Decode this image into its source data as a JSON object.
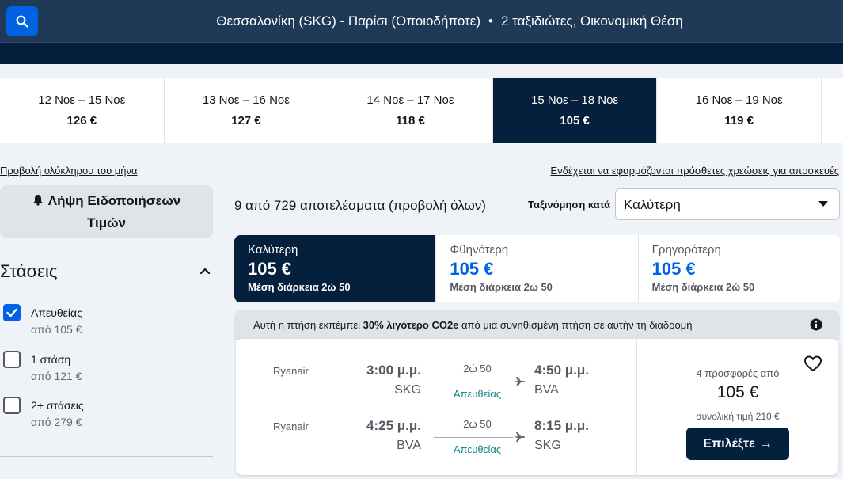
{
  "search": {
    "route": "Θεσσαλονίκη (SKG) - Παρίσι (Οποιοδήποτε)",
    "separator": "•",
    "travellers": "2 ταξιδιώτες, Οικονομική Θέση"
  },
  "dates": [
    {
      "range": "12 Νοε – 15 Νοε",
      "price": "126 €"
    },
    {
      "range": "13 Νοε – 16 Νοε",
      "price": "127 €"
    },
    {
      "range": "14 Νοε – 17 Νοε",
      "price": "118 €"
    },
    {
      "range": "15 Νοε – 18 Νοε",
      "price": "105 €",
      "selected": true
    },
    {
      "range": "16 Νοε – 19 Νοε",
      "price": "119 €"
    }
  ],
  "links": {
    "month": "Προβολή ολόκληρου του μήνα",
    "baggage": "Ενδέχεται να εφαρμόζονται πρόσθετες χρεώσεις για αποσκευές"
  },
  "alerts": {
    "label": "Λήψη Ειδοποιήσεων Τιμών"
  },
  "filters": {
    "stops_title": "Στάσεις",
    "items": [
      {
        "label": "Απευθείας",
        "price": "από 105 €",
        "checked": true
      },
      {
        "label": "1 στάση",
        "price": "από 121 €",
        "checked": false
      },
      {
        "label": "2+ στάσεις",
        "price": "από 279 €",
        "checked": false
      }
    ]
  },
  "results": {
    "count": "9 από 729 αποτελέσματα (προβολή όλων)",
    "sort_label": "Ταξινόμηση κατά",
    "sort_value": "Καλύτερη"
  },
  "sort_tabs": [
    {
      "title": "Καλύτερη",
      "price": "105 €",
      "duration": "Μέση διάρκεια 2ώ 50",
      "active": true
    },
    {
      "title": "Φθηνότερη",
      "price": "105 €",
      "duration": "Μέση διάρκεια 2ώ 50",
      "active": false
    },
    {
      "title": "Γρηγορότερη",
      "price": "105 €",
      "duration": "Μέση διάρκεια 2ώ 50",
      "active": false
    }
  ],
  "eco": {
    "prefix": "Αυτή η πτήση εκπέμπει ",
    "highlight": "30% λιγότερο CO2e",
    "suffix": " από μια συνηθισμένη πτήση σε αυτήν τη διαδρομή"
  },
  "flight": {
    "legs": [
      {
        "airline": "Ryanair",
        "dep_time": "3:00 μ.μ.",
        "dep_code": "SKG",
        "duration": "2ώ 50",
        "stops": "Απευθείας",
        "arr_time": "4:50 μ.μ.",
        "arr_code": "BVA"
      },
      {
        "airline": "Ryanair",
        "dep_time": "4:25 μ.μ.",
        "dep_code": "BVA",
        "duration": "2ώ 50",
        "stops": "Απευθείας",
        "arr_time": "8:15 μ.μ.",
        "arr_code": "SKG"
      }
    ],
    "offers": "4 προσφορές από",
    "price": "105 €",
    "total": "συνολική τιμή 210 €",
    "select_label": "Επιλέξτε",
    "select_arrow": "→"
  },
  "colors": {
    "brand_dark": "#05203c",
    "accent_blue": "#0062e3",
    "direct_teal": "#0c838a"
  }
}
